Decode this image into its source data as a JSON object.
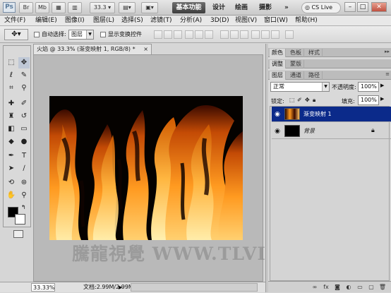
{
  "app": {
    "logo": "Ps",
    "zoom_value": "33.3",
    "workspaces": [
      "基本功能",
      "设计",
      "绘画",
      "摄影"
    ],
    "more": "»",
    "cs_live": "CS Live"
  },
  "menu": [
    "文件(F)",
    "编辑(E)",
    "图像(I)",
    "图层(L)",
    "选择(S)",
    "滤镜(T)",
    "分析(A)",
    "3D(D)",
    "视图(V)",
    "窗口(W)",
    "帮助(H)"
  ],
  "options": {
    "auto_select_label": "自动选择:",
    "auto_select_value": "图层",
    "transform_label": "显示变换控件"
  },
  "document": {
    "tab_title": "火焰 @ 33.3% (渐变映射 1, RGB/8) *",
    "close": "×"
  },
  "status": {
    "zoom": "33.33%",
    "doc_info": "文档:2.99M/2.99M"
  },
  "watermark": "騰龍視覺 WWW.TLVI.NET",
  "panels": {
    "group1_tabs": [
      "颜色",
      "色板",
      "样式"
    ],
    "group2_tabs": [
      "调整",
      "蒙版"
    ],
    "group3_tabs": [
      "图层",
      "通道",
      "路径"
    ],
    "blend_mode": "正常",
    "opacity_label": "不透明度:",
    "opacity_value": "100%",
    "lock_label": "锁定:",
    "fill_label": "填充:",
    "fill_value": "100%",
    "layers": [
      {
        "name": "渐变映射 1",
        "selected": true
      },
      {
        "name": "背景",
        "selected": false
      }
    ]
  },
  "colors": {
    "selected_layer": "#0b2a8a",
    "foreground": "#000000",
    "background": "#ffffff"
  }
}
